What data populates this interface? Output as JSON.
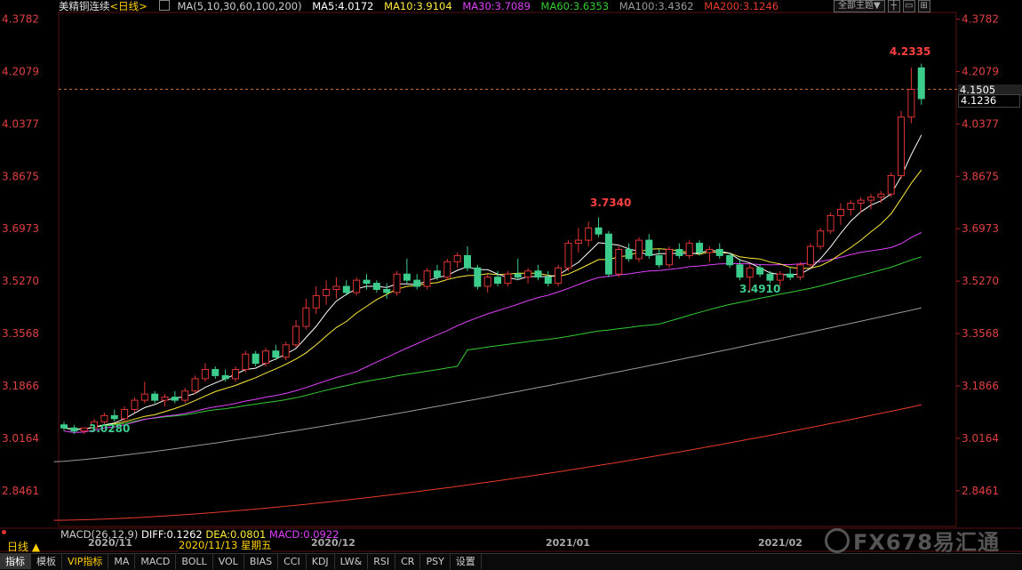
{
  "header": {
    "title": "美精铜连续",
    "period": "<日线>",
    "ma_label": "MA(5,10,30,60,100,200)",
    "ma5": "MA5:4.0172",
    "ma10": "MA10:3.9104",
    "ma30": "MA30:3.7089",
    "ma60": "MA60:3.6353",
    "ma100": "MA100:3.4362",
    "ma200": "MA200:3.1246",
    "theme_button": "全部主题▼"
  },
  "price_tags": {
    "last_price": "4.1505",
    "current_price": "4.1236"
  },
  "macd": {
    "label": "MACD(26,12,9)",
    "diff": "DIFF:0.1262",
    "dea": "DEA:0.0801",
    "macd": "MACD:0.0922"
  },
  "date_tag": "2020/11/13 星期五",
  "period_label": "日线 ▲",
  "months": [
    "2020/11",
    "2020/12",
    "2021/01",
    "2021/02"
  ],
  "tabs": [
    "指标",
    "模板",
    "VIP指标",
    "MA",
    "MACD",
    "BOLL",
    "VOL",
    "BIAS",
    "CCI",
    "KDJ",
    "LW&",
    "RSI",
    "CR",
    "PSY",
    "设置"
  ],
  "watermark": "FX678易汇通",
  "colors": {
    "up": "#e03434",
    "down": "#3ccc8c",
    "ma5": "#ffffff",
    "ma10": "#ffeb3b",
    "ma30": "#e040fb",
    "ma60": "#33cc33",
    "ma100": "#999999",
    "ma200": "#e83a2a"
  },
  "chart_data": {
    "type": "candlestick",
    "y_axis_ticks": [
      4.3782,
      4.2079,
      4.0377,
      3.8675,
      3.6973,
      3.527,
      3.3568,
      3.1866,
      3.0164,
      2.8461
    ],
    "ylim": [
      2.73,
      4.4
    ],
    "annotations": [
      {
        "label": "4.2335",
        "value": 4.2335,
        "kind": "high"
      },
      {
        "label": "3.7340",
        "value": 3.734,
        "kind": "high"
      },
      {
        "label": "3.4910",
        "value": 3.491,
        "kind": "low"
      },
      {
        "label": "3.0280",
        "value": 3.028,
        "kind": "low"
      }
    ],
    "ref_line": 4.1505,
    "candles": [
      [
        3.06,
        3.07,
        3.04,
        3.05
      ],
      [
        3.05,
        3.06,
        3.03,
        3.04
      ],
      [
        3.04,
        3.05,
        3.03,
        3.05
      ],
      [
        3.05,
        3.08,
        3.04,
        3.07
      ],
      [
        3.07,
        3.1,
        3.06,
        3.09
      ],
      [
        3.09,
        3.11,
        3.07,
        3.08
      ],
      [
        3.08,
        3.12,
        3.07,
        3.11
      ],
      [
        3.11,
        3.15,
        3.1,
        3.14
      ],
      [
        3.14,
        3.2,
        3.13,
        3.16
      ],
      [
        3.16,
        3.17,
        3.13,
        3.14
      ],
      [
        3.14,
        3.16,
        3.12,
        3.15
      ],
      [
        3.15,
        3.17,
        3.13,
        3.14
      ],
      [
        3.14,
        3.18,
        3.13,
        3.17
      ],
      [
        3.17,
        3.22,
        3.16,
        3.21
      ],
      [
        3.21,
        3.26,
        3.2,
        3.24
      ],
      [
        3.24,
        3.25,
        3.21,
        3.22
      ],
      [
        3.22,
        3.24,
        3.2,
        3.21
      ],
      [
        3.21,
        3.25,
        3.2,
        3.24
      ],
      [
        3.24,
        3.3,
        3.23,
        3.29
      ],
      [
        3.29,
        3.3,
        3.25,
        3.26
      ],
      [
        3.26,
        3.31,
        3.25,
        3.3
      ],
      [
        3.3,
        3.32,
        3.27,
        3.28
      ],
      [
        3.28,
        3.33,
        3.27,
        3.32
      ],
      [
        3.32,
        3.4,
        3.31,
        3.38
      ],
      [
        3.38,
        3.47,
        3.37,
        3.44
      ],
      [
        3.44,
        3.51,
        3.42,
        3.48
      ],
      [
        3.48,
        3.53,
        3.45,
        3.5
      ],
      [
        3.5,
        3.54,
        3.47,
        3.51
      ],
      [
        3.51,
        3.53,
        3.48,
        3.49
      ],
      [
        3.49,
        3.54,
        3.48,
        3.53
      ],
      [
        3.53,
        3.55,
        3.5,
        3.52
      ],
      [
        3.52,
        3.53,
        3.49,
        3.5
      ],
      [
        3.5,
        3.52,
        3.47,
        3.49
      ],
      [
        3.49,
        3.56,
        3.48,
        3.55
      ],
      [
        3.55,
        3.6,
        3.52,
        3.53
      ],
      [
        3.53,
        3.55,
        3.5,
        3.51
      ],
      [
        3.51,
        3.57,
        3.5,
        3.56
      ],
      [
        3.56,
        3.58,
        3.53,
        3.54
      ],
      [
        3.54,
        3.6,
        3.53,
        3.59
      ],
      [
        3.59,
        3.62,
        3.57,
        3.61
      ],
      [
        3.61,
        3.64,
        3.56,
        3.57
      ],
      [
        3.57,
        3.58,
        3.5,
        3.51
      ],
      [
        3.51,
        3.55,
        3.49,
        3.54
      ],
      [
        3.54,
        3.56,
        3.51,
        3.52
      ],
      [
        3.52,
        3.56,
        3.51,
        3.55
      ],
      [
        3.55,
        3.6,
        3.53,
        3.54
      ],
      [
        3.54,
        3.57,
        3.52,
        3.56
      ],
      [
        3.56,
        3.58,
        3.53,
        3.54
      ],
      [
        3.54,
        3.56,
        3.51,
        3.52
      ],
      [
        3.52,
        3.58,
        3.51,
        3.57
      ],
      [
        3.57,
        3.66,
        3.56,
        3.65
      ],
      [
        3.65,
        3.7,
        3.62,
        3.66
      ],
      [
        3.66,
        3.72,
        3.64,
        3.7
      ],
      [
        3.7,
        3.734,
        3.67,
        3.68
      ],
      [
        3.68,
        3.69,
        3.54,
        3.55
      ],
      [
        3.55,
        3.64,
        3.54,
        3.63
      ],
      [
        3.63,
        3.65,
        3.59,
        3.6
      ],
      [
        3.6,
        3.67,
        3.59,
        3.66
      ],
      [
        3.66,
        3.68,
        3.6,
        3.61
      ],
      [
        3.61,
        3.63,
        3.57,
        3.58
      ],
      [
        3.58,
        3.64,
        3.57,
        3.63
      ],
      [
        3.63,
        3.65,
        3.6,
        3.61
      ],
      [
        3.61,
        3.66,
        3.6,
        3.65
      ],
      [
        3.65,
        3.66,
        3.61,
        3.62
      ],
      [
        3.62,
        3.64,
        3.59,
        3.63
      ],
      [
        3.63,
        3.65,
        3.6,
        3.61
      ],
      [
        3.61,
        3.62,
        3.57,
        3.58
      ],
      [
        3.58,
        3.6,
        3.53,
        3.54
      ],
      [
        3.54,
        3.58,
        3.491,
        3.57
      ],
      [
        3.57,
        3.58,
        3.54,
        3.55
      ],
      [
        3.55,
        3.56,
        3.52,
        3.53
      ],
      [
        3.53,
        3.56,
        3.51,
        3.55
      ],
      [
        3.55,
        3.57,
        3.53,
        3.54
      ],
      [
        3.54,
        3.59,
        3.53,
        3.58
      ],
      [
        3.58,
        3.65,
        3.57,
        3.64
      ],
      [
        3.64,
        3.7,
        3.63,
        3.69
      ],
      [
        3.69,
        3.75,
        3.68,
        3.74
      ],
      [
        3.74,
        3.78,
        3.71,
        3.76
      ],
      [
        3.76,
        3.79,
        3.74,
        3.78
      ],
      [
        3.78,
        3.8,
        3.75,
        3.79
      ],
      [
        3.79,
        3.81,
        3.76,
        3.8
      ],
      [
        3.8,
        3.82,
        3.78,
        3.81
      ],
      [
        3.81,
        3.88,
        3.8,
        3.87
      ],
      [
        3.87,
        4.08,
        3.86,
        4.06
      ],
      [
        4.06,
        4.22,
        4.04,
        4.15
      ],
      [
        4.22,
        4.2335,
        4.1,
        4.12
      ]
    ]
  }
}
